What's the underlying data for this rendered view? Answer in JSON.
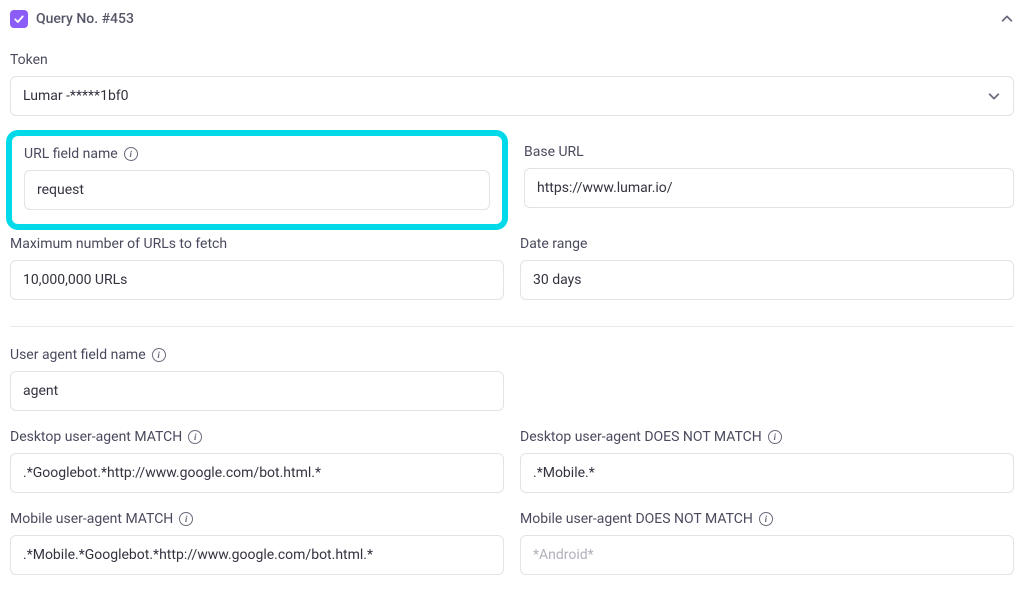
{
  "header": {
    "title": "Query No. #453"
  },
  "token": {
    "label": "Token",
    "value": "Lumar -*****1bf0"
  },
  "url_field_name": {
    "label": "URL field name",
    "value": "request"
  },
  "base_url": {
    "label": "Base URL",
    "value": "https://www.lumar.io/"
  },
  "max_urls": {
    "label": "Maximum number of URLs to fetch",
    "value": "10,000,000 URLs"
  },
  "date_range": {
    "label": "Date range",
    "value": "30 days"
  },
  "ua_field_name": {
    "label": "User agent field name",
    "value": "agent"
  },
  "desktop_ua_match": {
    "label": "Desktop user-agent MATCH",
    "value": ".*Googlebot.*http://www.google.com/bot.html.*"
  },
  "desktop_ua_not_match": {
    "label": "Desktop user-agent DOES NOT MATCH",
    "value": ".*Mobile.*"
  },
  "mobile_ua_match": {
    "label": "Mobile user-agent MATCH",
    "value": ".*Mobile.*Googlebot.*http://www.google.com/bot.html.*"
  },
  "mobile_ua_not_match": {
    "label": "Mobile user-agent DOES NOT MATCH",
    "value": "",
    "placeholder": "*Android*"
  }
}
